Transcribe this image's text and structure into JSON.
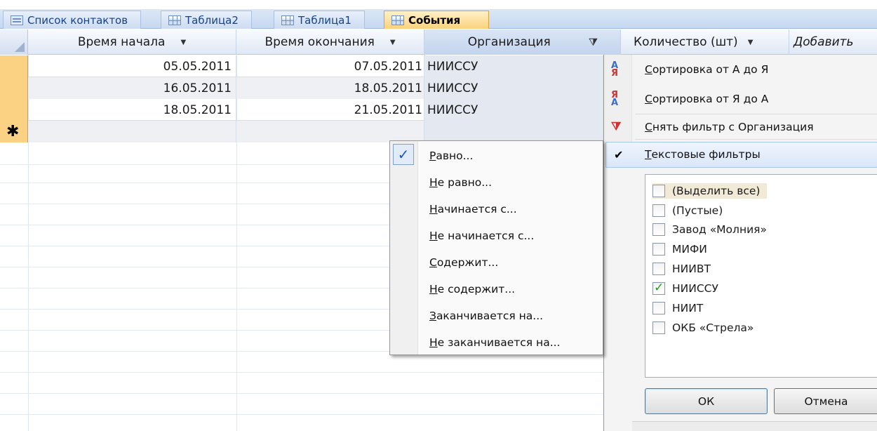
{
  "tabs": [
    {
      "label": "Список контактов",
      "icon": "form-icon"
    },
    {
      "label": "Таблица2",
      "icon": "table-icon"
    },
    {
      "label": "Таблица1",
      "icon": "table-icon"
    },
    {
      "label": "События",
      "icon": "table-icon",
      "active": true
    }
  ],
  "columns": {
    "start_time": "Время начала",
    "end_time": "Время окончания",
    "organization": "Организация",
    "quantity": "Количество (шт)",
    "add_field": "Добавить"
  },
  "rows": [
    {
      "start": "05.05.2011",
      "end": "07.05.2011",
      "org": "НИИССУ"
    },
    {
      "start": "16.05.2011",
      "end": "18.05.2011",
      "org": "НИИССУ"
    },
    {
      "start": "18.05.2011",
      "end": "21.05.2011",
      "org": "НИИССУ"
    }
  ],
  "new_record_marker": "✱",
  "filter_menu": {
    "sort_asc": "Сортировка от А до Я",
    "sort_desc": "Сортировка от Я до А",
    "clear_filter": "Снять фильтр с Организация",
    "text_filters": "Текстовые фильтры",
    "values": [
      {
        "label": "(Выделить все)",
        "checked": false
      },
      {
        "label": "(Пустые)",
        "checked": false
      },
      {
        "label": "Завод «Молния»",
        "checked": false
      },
      {
        "label": "МИФИ",
        "checked": false
      },
      {
        "label": "НИИВТ",
        "checked": false
      },
      {
        "label": "НИИССУ",
        "checked": true
      },
      {
        "label": "НИИТ",
        "checked": false
      },
      {
        "label": "ОКБ «Стрела»",
        "checked": false
      }
    ],
    "ok": "ОК",
    "cancel": "Отмена"
  },
  "text_filter_submenu": {
    "items": [
      "Равно...",
      "Не равно...",
      "Начинается с...",
      "Не начинается с...",
      "Содержит...",
      "Не содержит...",
      "Заканчивается на...",
      "Не заканчивается на..."
    ],
    "checked_item": "Равно..."
  },
  "colors": {
    "active_tab": "#fbd27c",
    "row_selector": "#fbd283",
    "checkbox_check": "#1ba01b"
  }
}
